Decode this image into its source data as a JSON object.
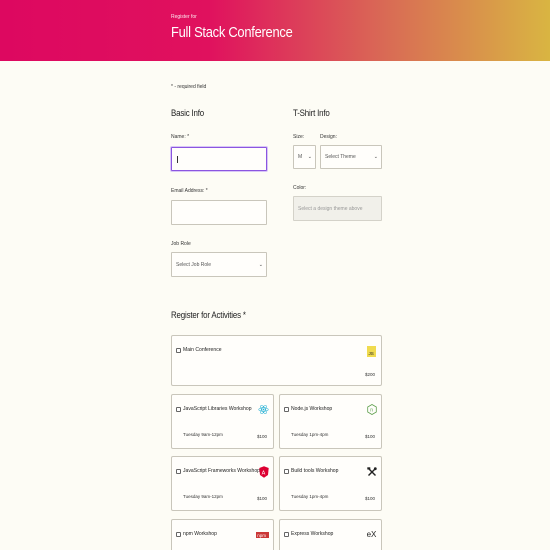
{
  "header": {
    "subtitle": "Register for",
    "title": "Full Stack Conference"
  },
  "required_note": "* - required field",
  "basic_info": {
    "heading": "Basic Info",
    "name_label": "Name: *",
    "name_value": "",
    "email_label": "Email Address: *",
    "email_value": "",
    "job_role_label": "Job Role",
    "job_role_selected": "Select Job Role"
  },
  "tshirt": {
    "heading": "T-Shirt Info",
    "size_label": "Size:",
    "size_selected": "M",
    "design_label": "Design:",
    "design_selected": "Select Theme",
    "color_label": "Color:",
    "color_selected": "Select a design theme above"
  },
  "activities": {
    "heading": "Register for Activities *",
    "items": [
      {
        "name": "Main Conference",
        "time": "",
        "price": "$200",
        "icon": "js-icon",
        "checked": false
      },
      {
        "name": "JavaScript Libraries Workshop",
        "time": "Tuesday 9am-12pm",
        "price": "$100",
        "icon": "react-icon",
        "checked": false
      },
      {
        "name": "Node.js Workshop",
        "time": "Tuesday 1pm-4pm",
        "price": "$100",
        "icon": "nodejs-icon",
        "checked": false
      },
      {
        "name": "JavaScript Frameworks Workshop",
        "time": "Tuesday 9am-12pm",
        "price": "$100",
        "icon": "angular-icon",
        "checked": false
      },
      {
        "name": "Build tools Workshop",
        "time": "Tuesday 1pm-4pm",
        "price": "$100",
        "icon": "tools-icon",
        "checked": false
      },
      {
        "name": "npm Workshop",
        "time": "",
        "price": "",
        "icon": "npm-icon",
        "checked": false
      },
      {
        "name": "Express Workshop",
        "time": "",
        "price": "",
        "icon": "express-icon",
        "checked": false
      }
    ]
  },
  "colors": {
    "header_start": "#dd0860",
    "header_end": "#d9b542",
    "focus": "#8b55e0",
    "background": "#fdfcf5"
  }
}
